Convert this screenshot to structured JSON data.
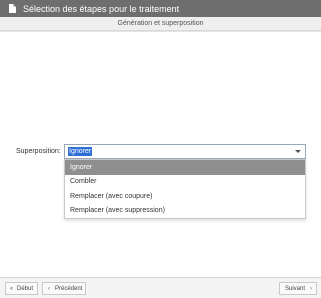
{
  "window": {
    "title": "Sélection des étapes pour le traitement",
    "icon": "document-icon"
  },
  "section": {
    "header": "Génération et superposition"
  },
  "field": {
    "label": "Superposition:",
    "value": "Ignorer",
    "options": [
      "Ignorer",
      "Combler",
      "Remplacer (avec coupure)",
      "Remplacer (avec suppression)"
    ],
    "selected_index": 0
  },
  "footer": {
    "first_label": "Début",
    "prev_label": "Précédent",
    "next_label": "Suivant",
    "first_icon": "double-chevron-left-icon",
    "prev_icon": "chevron-left-icon",
    "next_icon": "chevron-right-icon"
  },
  "colors": {
    "titlebar": "#6e6e6e",
    "selection": "#2f6fd6",
    "highlight_option": "#8f8f8f"
  }
}
